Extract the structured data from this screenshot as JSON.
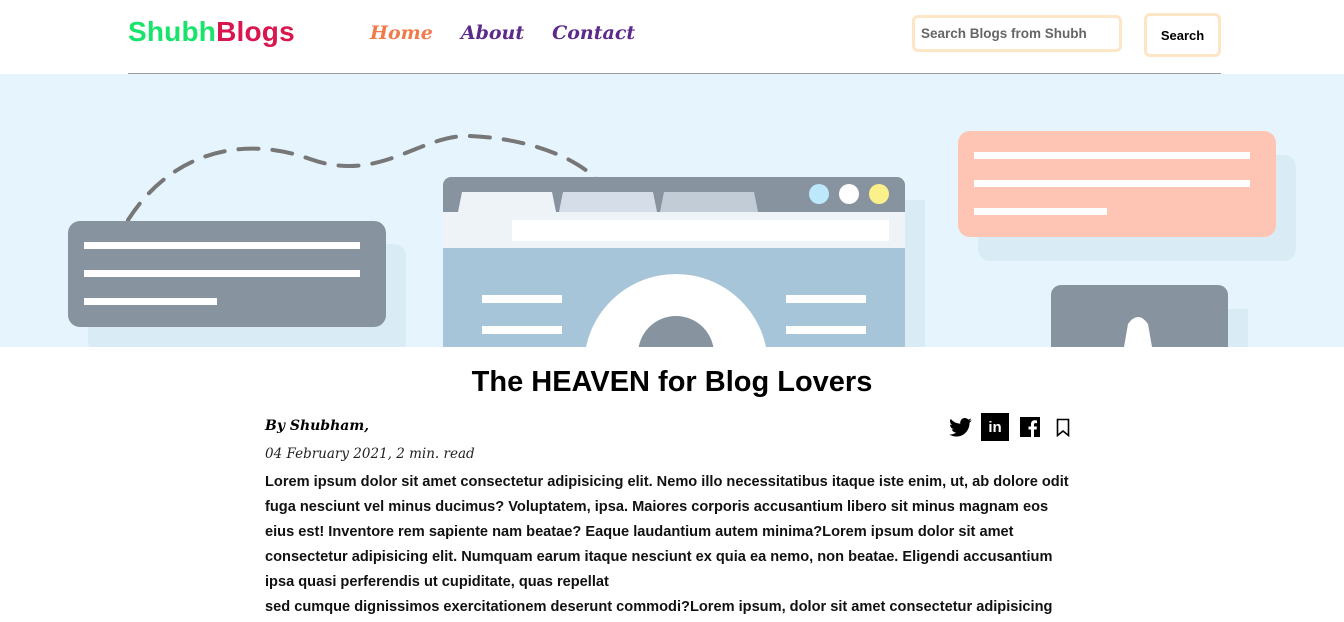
{
  "brand": {
    "part1": "Shubh",
    "part2": "Blogs",
    "color1": "#19e36d",
    "color2": "#d9174f"
  },
  "nav": {
    "home": "Home",
    "about": "About",
    "contact": "Contact",
    "home_color": "#f07a4a",
    "link_color": "#5c2a8a"
  },
  "search": {
    "placeholder": "Search Blogs from Shubh",
    "button_label": "Search"
  },
  "hero": {
    "icons": [
      "chat-bubble-grey",
      "browser-window",
      "chat-bubble-peach",
      "device-card"
    ]
  },
  "article": {
    "title": "The HEAVEN for Blog Lovers",
    "author": "By Shubham,",
    "date_read": "04 February 2021, 2 min. read",
    "paragraph1": "Lorem ipsum dolor sit amet consectetur adipisicing elit. Nemo illo necessitatibus itaque iste enim, ut, ab dolore odit fuga nesciunt vel minus ducimus? Voluptatem, ipsa. Maiores corporis accusantium libero sit minus magnam eos eius est! Inventore rem sapiente nam beatae? Eaque laudantium autem minima?Lorem ipsum dolor sit amet consectetur adipisicing elit. Numquam earum itaque nesciunt ex quia ea nemo, non beatae. Eligendi accusantium ipsa quasi perferendis ut cupiditate, quas repellat",
    "paragraph2": "sed cumque dignissimos exercitationem deserunt commodi?Lorem ipsum, dolor sit amet consectetur adipisicing"
  },
  "share": {
    "icons": [
      "twitter-icon",
      "linkedin-icon",
      "facebook-icon",
      "bookmark-icon"
    ],
    "linkedin_label": "in"
  }
}
